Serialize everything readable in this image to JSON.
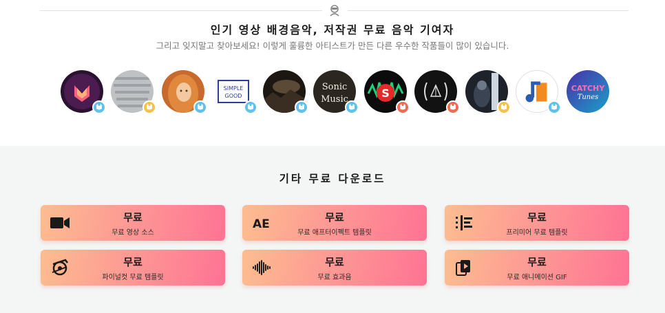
{
  "header": {
    "badge_icon": "robot-icon",
    "title": "인기 영상 배경음악, 저작권 무료 음악 기여자",
    "subtitle": "그리고 잊지말고 찾아보세요! 이렇게 훌륭한 아티스트가 만든 다른 우수한 작품들이 많이 있습니다."
  },
  "contributors": [
    {
      "avatar": "purple-logo",
      "tag_color": "blue",
      "tag_icon": "cat-badge-icon"
    },
    {
      "avatar": "metal-texture",
      "tag_color": "yellow",
      "tag_icon": "cat-badge-icon"
    },
    {
      "avatar": "portrait-redhead",
      "tag_color": "blue",
      "tag_icon": "cat-badge-icon"
    },
    {
      "avatar": "simple-good-logo",
      "text": "SIMPLE GOOD",
      "tag_color": "blue",
      "tag_icon": "cat-badge-icon"
    },
    {
      "avatar": "dark-landscape",
      "tag_color": "blue",
      "tag_icon": "cat-badge-icon"
    },
    {
      "avatar": "sonic-music-logo",
      "text": "Sonic Music",
      "tag_color": "blue",
      "tag_icon": "cat-badge-icon"
    },
    {
      "avatar": "red-s-logo",
      "text": "S",
      "tag_color": "red",
      "tag_icon": "cat-badge-icon"
    },
    {
      "avatar": "laurel-logo",
      "tag_color": "red",
      "tag_icon": "cat-badge-icon"
    },
    {
      "avatar": "night-photo",
      "tag_color": "yellow",
      "tag_icon": "cat-badge-icon"
    },
    {
      "avatar": "music-note-logo",
      "tag_color": "blue",
      "tag_icon": "cat-badge-icon"
    },
    {
      "avatar": "catchy-tunes-logo",
      "text": "CATCHY Tunes",
      "tag_color": "none",
      "tag_icon": ""
    }
  ],
  "downloads": {
    "title": "기타 무료 다운로드",
    "cards": [
      {
        "big": "무료",
        "small": "무료 영상 소스",
        "icon": "video-camera-icon"
      },
      {
        "big": "무료",
        "small": "무료 애프터이펙트 템플릿",
        "icon": "after-effects-icon"
      },
      {
        "big": "무료",
        "small": "프리미어 무료 템플릿",
        "icon": "premiere-timeline-icon"
      },
      {
        "big": "무료",
        "small": "파이널컷 무료 템플릿",
        "icon": "final-cut-icon"
      },
      {
        "big": "무료",
        "small": "무료 효과음",
        "icon": "sound-wave-icon"
      },
      {
        "big": "무료",
        "small": "무료 애니메이션 GIF",
        "icon": "gif-stack-icon"
      }
    ]
  }
}
